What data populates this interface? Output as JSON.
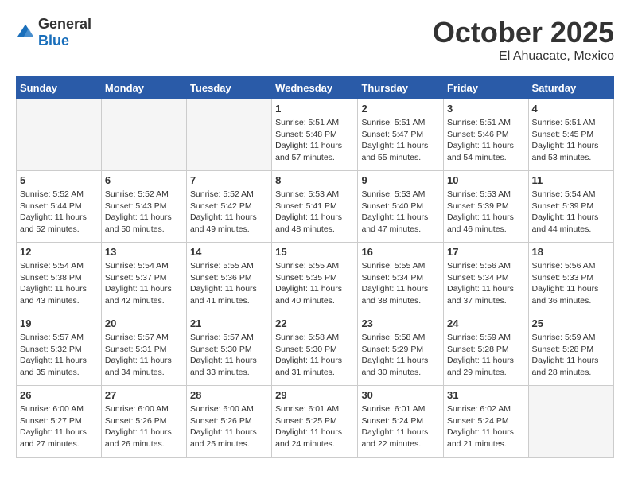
{
  "header": {
    "logo_general": "General",
    "logo_blue": "Blue",
    "month_title": "October 2025",
    "location": "El Ahuacate, Mexico"
  },
  "weekdays": [
    "Sunday",
    "Monday",
    "Tuesday",
    "Wednesday",
    "Thursday",
    "Friday",
    "Saturday"
  ],
  "weeks": [
    [
      {
        "day": "",
        "info": ""
      },
      {
        "day": "",
        "info": ""
      },
      {
        "day": "",
        "info": ""
      },
      {
        "day": "1",
        "info": "Sunrise: 5:51 AM\nSunset: 5:48 PM\nDaylight: 11 hours\nand 57 minutes."
      },
      {
        "day": "2",
        "info": "Sunrise: 5:51 AM\nSunset: 5:47 PM\nDaylight: 11 hours\nand 55 minutes."
      },
      {
        "day": "3",
        "info": "Sunrise: 5:51 AM\nSunset: 5:46 PM\nDaylight: 11 hours\nand 54 minutes."
      },
      {
        "day": "4",
        "info": "Sunrise: 5:51 AM\nSunset: 5:45 PM\nDaylight: 11 hours\nand 53 minutes."
      }
    ],
    [
      {
        "day": "5",
        "info": "Sunrise: 5:52 AM\nSunset: 5:44 PM\nDaylight: 11 hours\nand 52 minutes."
      },
      {
        "day": "6",
        "info": "Sunrise: 5:52 AM\nSunset: 5:43 PM\nDaylight: 11 hours\nand 50 minutes."
      },
      {
        "day": "7",
        "info": "Sunrise: 5:52 AM\nSunset: 5:42 PM\nDaylight: 11 hours\nand 49 minutes."
      },
      {
        "day": "8",
        "info": "Sunrise: 5:53 AM\nSunset: 5:41 PM\nDaylight: 11 hours\nand 48 minutes."
      },
      {
        "day": "9",
        "info": "Sunrise: 5:53 AM\nSunset: 5:40 PM\nDaylight: 11 hours\nand 47 minutes."
      },
      {
        "day": "10",
        "info": "Sunrise: 5:53 AM\nSunset: 5:39 PM\nDaylight: 11 hours\nand 46 minutes."
      },
      {
        "day": "11",
        "info": "Sunrise: 5:54 AM\nSunset: 5:39 PM\nDaylight: 11 hours\nand 44 minutes."
      }
    ],
    [
      {
        "day": "12",
        "info": "Sunrise: 5:54 AM\nSunset: 5:38 PM\nDaylight: 11 hours\nand 43 minutes."
      },
      {
        "day": "13",
        "info": "Sunrise: 5:54 AM\nSunset: 5:37 PM\nDaylight: 11 hours\nand 42 minutes."
      },
      {
        "day": "14",
        "info": "Sunrise: 5:55 AM\nSunset: 5:36 PM\nDaylight: 11 hours\nand 41 minutes."
      },
      {
        "day": "15",
        "info": "Sunrise: 5:55 AM\nSunset: 5:35 PM\nDaylight: 11 hours\nand 40 minutes."
      },
      {
        "day": "16",
        "info": "Sunrise: 5:55 AM\nSunset: 5:34 PM\nDaylight: 11 hours\nand 38 minutes."
      },
      {
        "day": "17",
        "info": "Sunrise: 5:56 AM\nSunset: 5:34 PM\nDaylight: 11 hours\nand 37 minutes."
      },
      {
        "day": "18",
        "info": "Sunrise: 5:56 AM\nSunset: 5:33 PM\nDaylight: 11 hours\nand 36 minutes."
      }
    ],
    [
      {
        "day": "19",
        "info": "Sunrise: 5:57 AM\nSunset: 5:32 PM\nDaylight: 11 hours\nand 35 minutes."
      },
      {
        "day": "20",
        "info": "Sunrise: 5:57 AM\nSunset: 5:31 PM\nDaylight: 11 hours\nand 34 minutes."
      },
      {
        "day": "21",
        "info": "Sunrise: 5:57 AM\nSunset: 5:30 PM\nDaylight: 11 hours\nand 33 minutes."
      },
      {
        "day": "22",
        "info": "Sunrise: 5:58 AM\nSunset: 5:30 PM\nDaylight: 11 hours\nand 31 minutes."
      },
      {
        "day": "23",
        "info": "Sunrise: 5:58 AM\nSunset: 5:29 PM\nDaylight: 11 hours\nand 30 minutes."
      },
      {
        "day": "24",
        "info": "Sunrise: 5:59 AM\nSunset: 5:28 PM\nDaylight: 11 hours\nand 29 minutes."
      },
      {
        "day": "25",
        "info": "Sunrise: 5:59 AM\nSunset: 5:28 PM\nDaylight: 11 hours\nand 28 minutes."
      }
    ],
    [
      {
        "day": "26",
        "info": "Sunrise: 6:00 AM\nSunset: 5:27 PM\nDaylight: 11 hours\nand 27 minutes."
      },
      {
        "day": "27",
        "info": "Sunrise: 6:00 AM\nSunset: 5:26 PM\nDaylight: 11 hours\nand 26 minutes."
      },
      {
        "day": "28",
        "info": "Sunrise: 6:00 AM\nSunset: 5:26 PM\nDaylight: 11 hours\nand 25 minutes."
      },
      {
        "day": "29",
        "info": "Sunrise: 6:01 AM\nSunset: 5:25 PM\nDaylight: 11 hours\nand 24 minutes."
      },
      {
        "day": "30",
        "info": "Sunrise: 6:01 AM\nSunset: 5:24 PM\nDaylight: 11 hours\nand 22 minutes."
      },
      {
        "day": "31",
        "info": "Sunrise: 6:02 AM\nSunset: 5:24 PM\nDaylight: 11 hours\nand 21 minutes."
      },
      {
        "day": "",
        "info": ""
      }
    ]
  ]
}
